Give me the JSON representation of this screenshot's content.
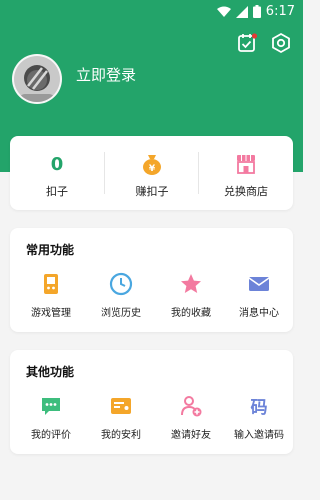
{
  "status_bar": {
    "time": "6:17"
  },
  "header": {
    "login_text": "立即登录"
  },
  "stats": [
    {
      "value": "0",
      "label": "扣子"
    },
    {
      "label": "赚扣子",
      "icon": "money-bag-icon"
    },
    {
      "label": "兑换商店",
      "icon": "store-icon"
    }
  ],
  "common": {
    "title": "常用功能",
    "items": [
      {
        "label": "游戏管理",
        "icon": "game-manage-icon"
      },
      {
        "label": "浏览历史",
        "icon": "history-clock-icon"
      },
      {
        "label": "我的收藏",
        "icon": "star-icon"
      },
      {
        "label": "消息中心",
        "icon": "envelope-icon"
      }
    ]
  },
  "other": {
    "title": "其他功能",
    "items": [
      {
        "label": "我的评价",
        "icon": "comment-icon"
      },
      {
        "label": "我的安利",
        "icon": "recommend-card-icon"
      },
      {
        "label": "邀请好友",
        "icon": "invite-friend-icon"
      },
      {
        "label": "输入邀请码",
        "icon": "invite-code-icon"
      }
    ]
  },
  "colors": {
    "primary": "#23a46a",
    "accent_orange": "#f4a62a",
    "accent_pink": "#f37aa0",
    "accent_blue": "#4aa7e0"
  }
}
